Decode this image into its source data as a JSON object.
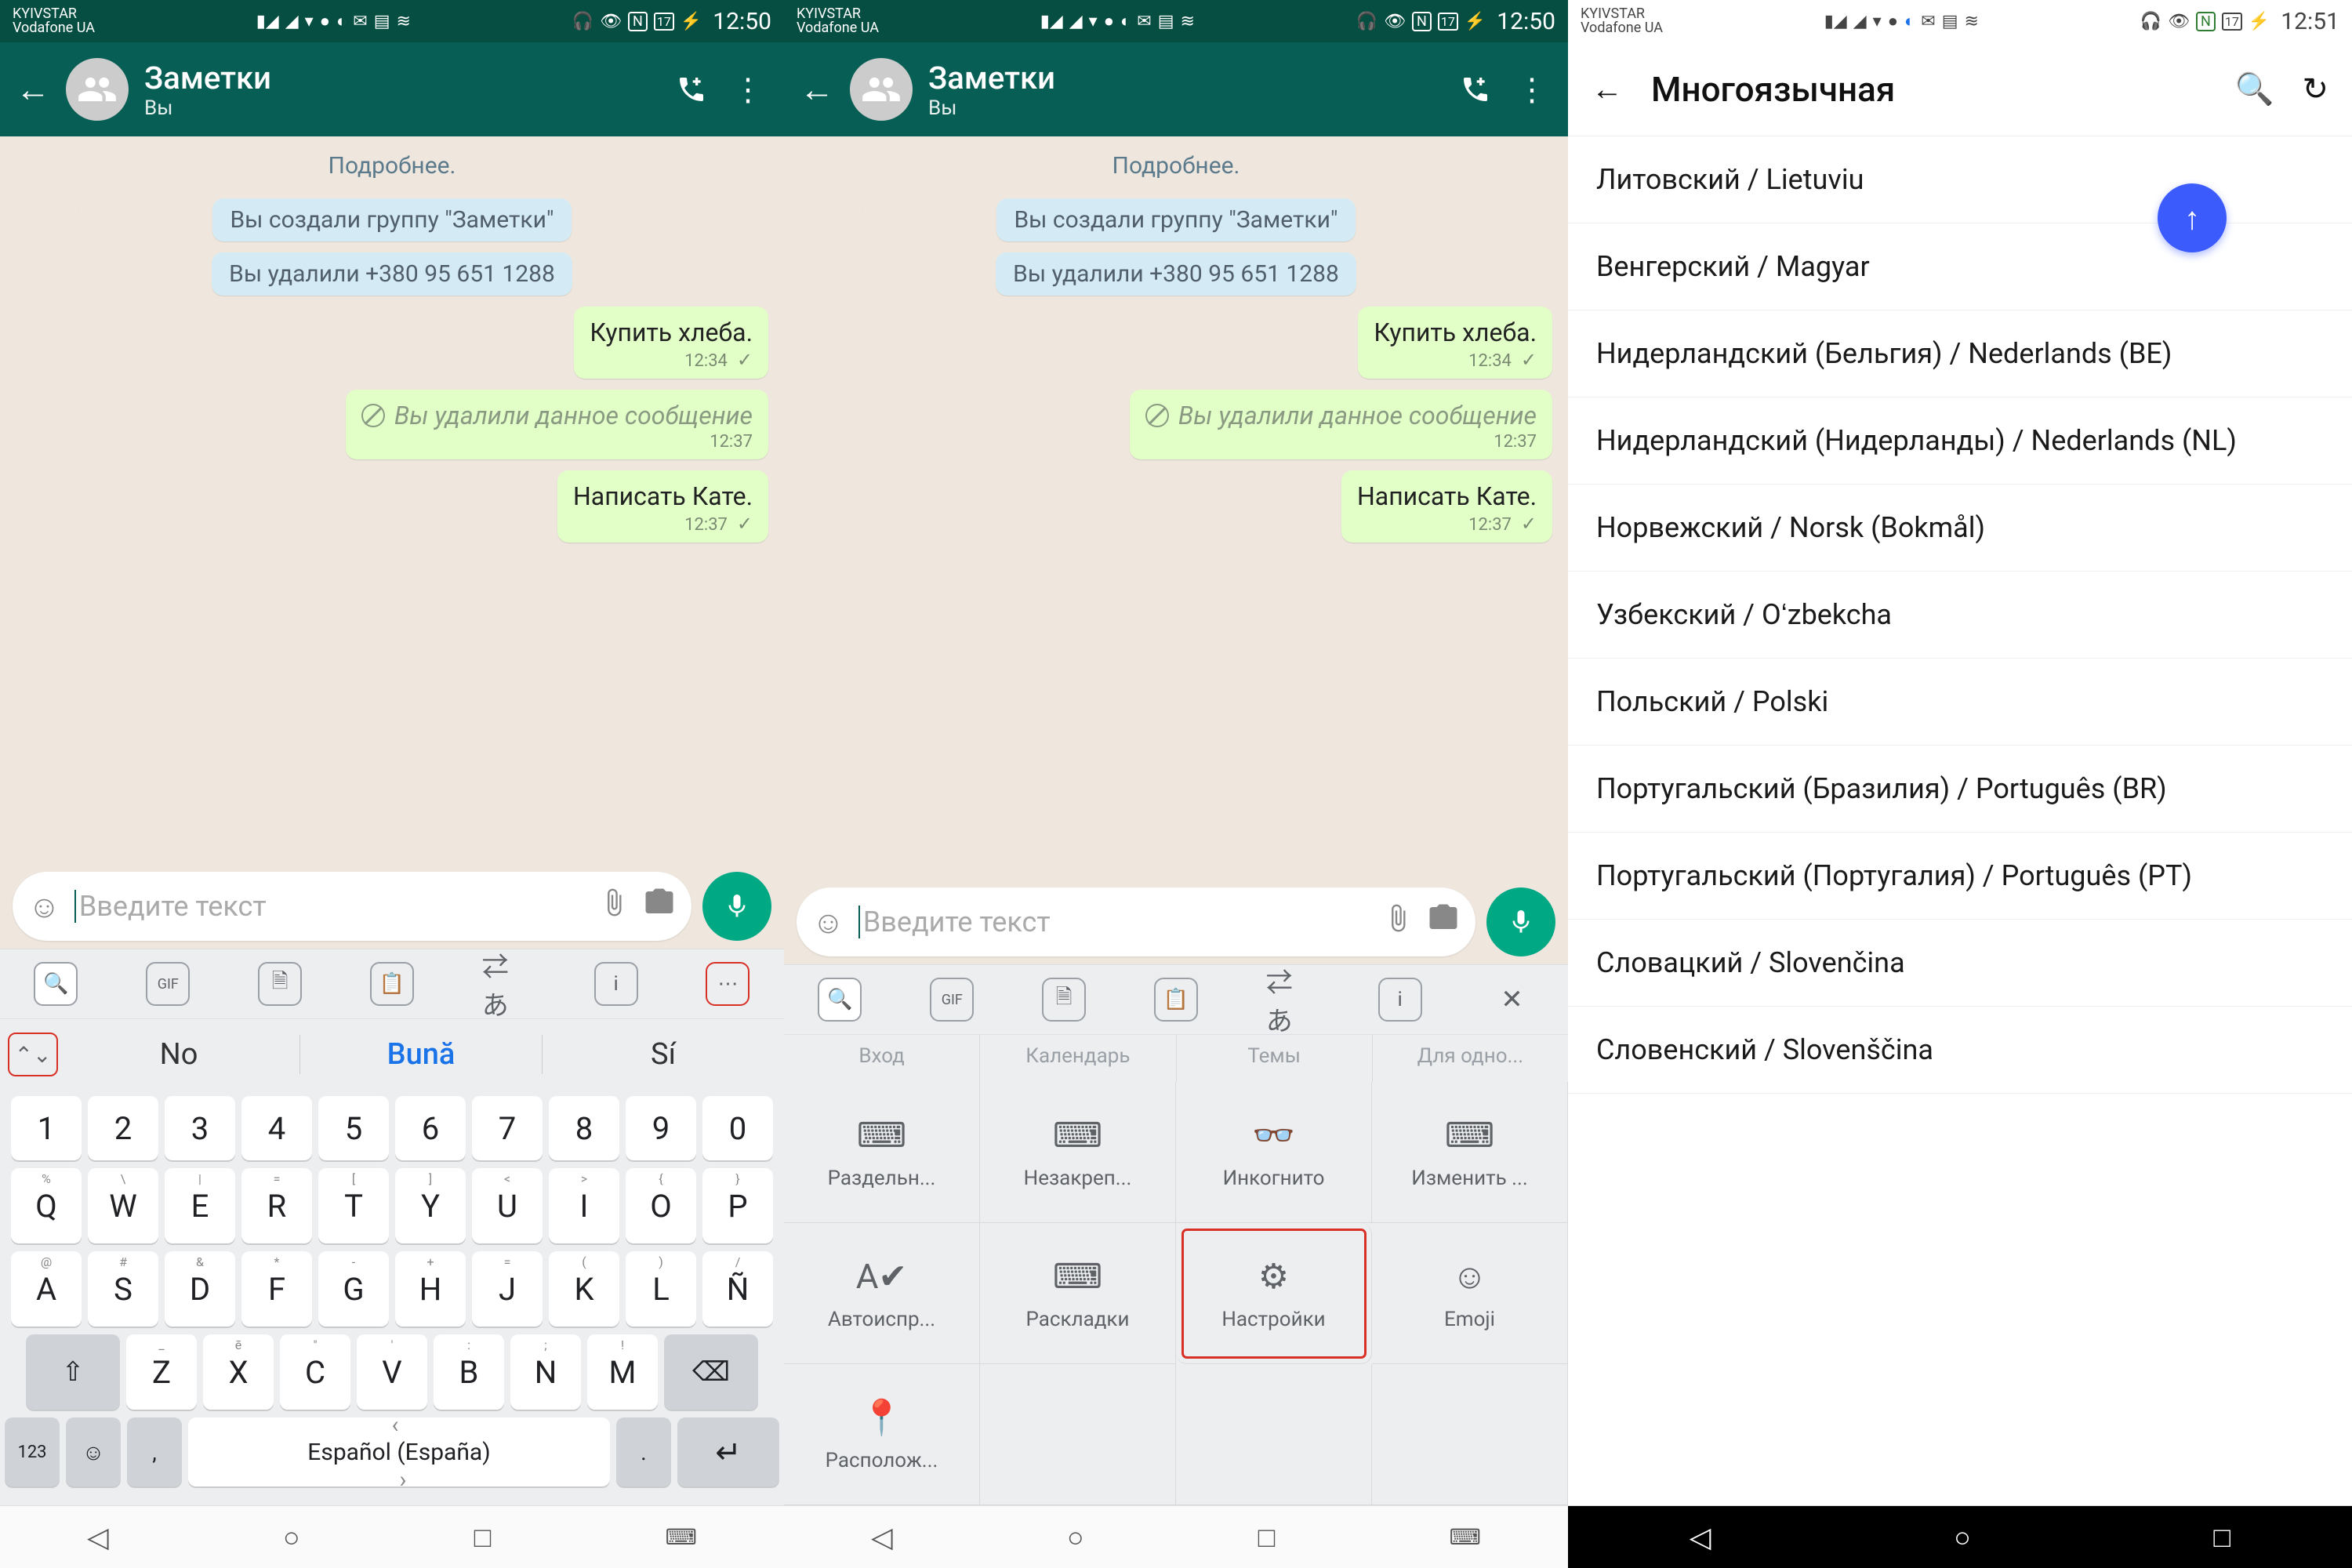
{
  "status": {
    "carrier1": "KYIVSTAR",
    "carrier2": "Vodafone UA",
    "battery": "17",
    "time_a": "12:50",
    "time_c": "12:51"
  },
  "wa": {
    "title": "Заметки",
    "subtitle": "Вы",
    "more_link": "Подробнее.",
    "sys1": "Вы создали группу \"Заметки\"",
    "sys2": "Вы удалили +380 95 651 1288",
    "msg1": "Купить хлеба.",
    "msg1_time": "12:34",
    "deleted": "Вы удалили данное сообщение",
    "deleted_time": "12:37",
    "msg2": "Написать Кате.",
    "msg2_time": "12:37",
    "placeholder": "Введите текст"
  },
  "kbd_toolbar": {
    "gif": "GIF"
  },
  "sugg": {
    "left": "No",
    "center": "Bună",
    "right": "Sí"
  },
  "keys": {
    "nums": [
      "1",
      "2",
      "3",
      "4",
      "5",
      "6",
      "7",
      "8",
      "9",
      "0"
    ],
    "row1": [
      "Q",
      "W",
      "E",
      "R",
      "T",
      "Y",
      "U",
      "I",
      "O",
      "P"
    ],
    "row1_hints": [
      "%",
      "\\",
      "|",
      "=",
      "[",
      "]",
      "<",
      ">",
      "{",
      "}"
    ],
    "row2": [
      "A",
      "S",
      "D",
      "F",
      "G",
      "H",
      "J",
      "K",
      "L",
      "Ñ"
    ],
    "row2_hints": [
      "@",
      "#",
      "&",
      "*",
      "-",
      "+",
      "=",
      "(",
      ")",
      "/"
    ],
    "row3": [
      "Z",
      "X",
      "C",
      "V",
      "B",
      "N",
      "M"
    ],
    "row3_hints": [
      "_",
      "ē",
      "\"",
      "'",
      ":",
      ";",
      "!"
    ],
    "space": "Español (España)",
    "numkey": "123"
  },
  "hints": {
    "a": "Вход",
    "b": "Календарь",
    "c": "Темы",
    "d": "Для одно..."
  },
  "shortcuts": {
    "s1": "Раздельн...",
    "s2": "Незакреп...",
    "s3": "Инкогнито",
    "s4": "Изменить ...",
    "s5": "Автоиспр...",
    "s6": "Раскладки",
    "s7": "Настройки",
    "s8": "Emoji",
    "s9": "Располож..."
  },
  "settings": {
    "title": "Многоязычная",
    "langs": [
      "Литовский / Lietuviu",
      "Венгерский / Magyar",
      "Нидерландский (Бельгия) / Nederlands (BE)",
      "Нидерландский (Нидерланды) / Nederlands (NL)",
      "Норвежский / Norsk (Bokmål)",
      "Узбекский / Oʻzbekcha",
      "Польский / Polski",
      "Португальский (Бразилия) / Português (BR)",
      "Португальский (Португалия) / Português (PT)",
      "Словацкий / Slovenčina",
      "Словенский / Slovenščina"
    ]
  }
}
